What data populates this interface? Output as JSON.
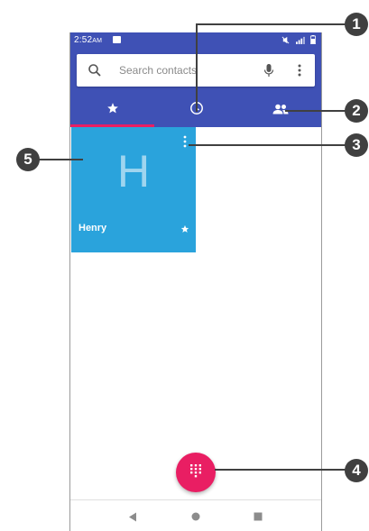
{
  "status_bar": {
    "time": "2:52",
    "ampm": "AM"
  },
  "search": {
    "placeholder": "Search contacts"
  },
  "tabs": [
    {
      "name": "favorites",
      "icon": "star-icon"
    },
    {
      "name": "recents",
      "icon": "clock-icon"
    },
    {
      "name": "contacts",
      "icon": "people-icon"
    }
  ],
  "favorite_tile": {
    "initial": "H",
    "name": "Henry",
    "color": "#2aa3dc"
  },
  "callouts": {
    "c1": "1",
    "c2": "2",
    "c3": "3",
    "c4": "4",
    "c5": "5"
  },
  "colors": {
    "app_bar": "#3f51b5",
    "accent": "#e91e63",
    "tile": "#2aa3dc"
  }
}
